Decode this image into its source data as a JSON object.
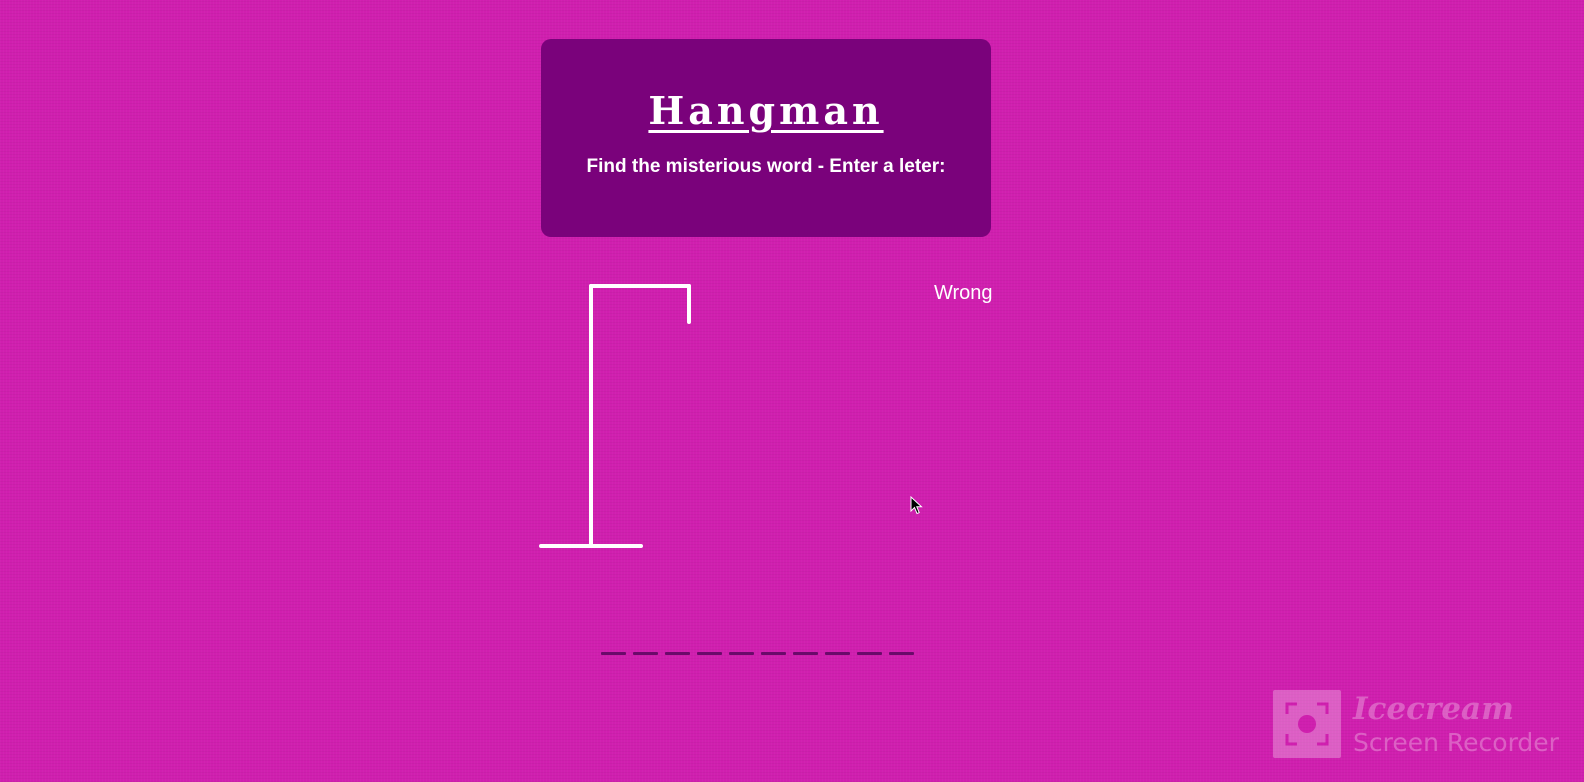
{
  "header": {
    "title": "Hangman",
    "instructions": "Find the misterious word - Enter a leter:"
  },
  "game": {
    "wrong_label": "Wrong",
    "word_length": 10,
    "guessed_letters": []
  },
  "watermark": {
    "brand": "Icecream",
    "product": "Screen Recorder"
  },
  "colors": {
    "background": "#d01faf",
    "card": "#7a027b",
    "text": "#ffffff",
    "word_slot": "#6b0a6a"
  },
  "icons": {
    "cursor": "arrow-cursor-icon",
    "watermark_logo": "screen-recorder-logo-icon"
  }
}
